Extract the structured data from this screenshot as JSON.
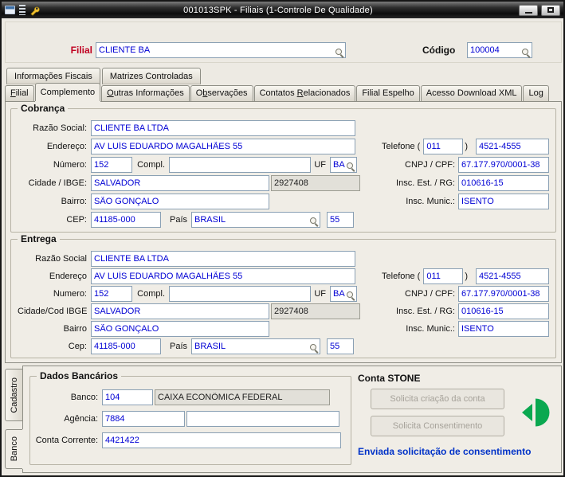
{
  "window": {
    "title": "001013SPK - Filiais (1-Controle De Qualidade)"
  },
  "colors": {
    "label_red": "#c00021",
    "input_text_blue": "#0000d4",
    "status_blue": "#0032c8",
    "stone_green": "#0aa850"
  },
  "icons": {
    "form": "form-window",
    "grip": "grip-dots",
    "wrench": "wrench",
    "minimize": "minimize-bar",
    "maximize": "maximize-box",
    "lookup": "magnifier",
    "stone": "stone-logo"
  },
  "header": {
    "filial_label": "Filial",
    "filial_value": "CLIENTE BA",
    "codigo_label": "Código",
    "codigo_value": "100004"
  },
  "fiscal_tabs": {
    "items": [
      {
        "label": "Informações Fiscais"
      },
      {
        "label": "Matrizes Controladas"
      }
    ]
  },
  "main_tabs": {
    "items": [
      {
        "pre": "",
        "u": "F",
        "post": "ilial"
      },
      {
        "pre": "Complemento",
        "u": "",
        "post": ""
      },
      {
        "pre": "",
        "u": "O",
        "post": "utras Informações"
      },
      {
        "pre": "O",
        "u": "b",
        "post": "servações"
      },
      {
        "pre": "Contatos ",
        "u": "R",
        "post": "elacionados"
      },
      {
        "pre": "Filial Espelho",
        "u": "",
        "post": ""
      },
      {
        "pre": "Acesso Download XML",
        "u": "",
        "post": ""
      },
      {
        "pre": "Log",
        "u": "",
        "post": ""
      }
    ]
  },
  "cobranca": {
    "title": "Cobrança",
    "labels": {
      "razao_social": "Razão Social:",
      "endereco": "Endereço:",
      "numero": "Número:",
      "compl": "Compl.",
      "uf": "UF",
      "cidade": "Cidade / IBGE:",
      "bairro": "Bairro:",
      "cep": "CEP:",
      "pais": "País",
      "telefone": "Telefone (",
      "telefone_close": ")",
      "cnpj": "CNPJ / CPF:",
      "insc_est": "Insc. Est. / RG:",
      "insc_munic": "Insc. Munic.:"
    },
    "values": {
      "razao_social": "CLIENTE BA LTDA",
      "endereco": "AV LUÍS EDUARDO MAGALHÃES 55",
      "numero": "152",
      "compl": "",
      "uf": "BA",
      "cidade": "SALVADOR",
      "ibge": "2927408",
      "bairro": "SÃO GONÇALO",
      "cep": "41185-000",
      "pais": "BRASIL",
      "pais_cod": "55",
      "ddd": "011",
      "telefone": "4521-4555",
      "cnpj": "67.177.970/0001-38",
      "insc_est": "010616-15",
      "insc_munic": "ISENTO"
    }
  },
  "entrega": {
    "title": "Entrega",
    "labels": {
      "razao_social": "Razão Social",
      "endereco": "Endereço",
      "numero": "Numero:",
      "compl": "Compl.",
      "uf": "UF",
      "cidade": "Cidade/Cod IBGE",
      "bairro": "Bairro",
      "cep": "Cep:",
      "pais": "País",
      "telefone": "Telefone (",
      "telefone_close": ")",
      "cnpj": "CNPJ / CPF:",
      "insc_est": "Insc. Est. / RG:",
      "insc_munic": "Insc. Munic.:"
    },
    "values": {
      "razao_social": "CLIENTE BA LTDA",
      "endereco": "AV LUÍS EDUARDO MAGALHÃES 55",
      "numero": "152",
      "compl": "",
      "uf": "BA",
      "cidade": "SALVADOR",
      "ibge": "2927408",
      "bairro": "SÃO GONÇALO",
      "cep": "41185-000",
      "pais": "BRASIL",
      "pais_cod": "55",
      "ddd": "011",
      "telefone": "4521-4555",
      "cnpj": "67.177.970/0001-38",
      "insc_est": "010616-15",
      "insc_munic": "ISENTO"
    }
  },
  "side_tabs": {
    "items": [
      {
        "label": "Cadastro"
      },
      {
        "label": "Banco"
      }
    ]
  },
  "dados_bancarios": {
    "title": "Dados Bancários",
    "banco_label": "Banco:",
    "banco_codigo": "104",
    "banco_nome": "CAIXA ECONÔMICA FEDERAL",
    "agencia_label": "Agência:",
    "agencia_value": "7884",
    "agencia_extra": "",
    "conta_label": "Conta Corrente:",
    "conta_value": "4421422"
  },
  "conta_stone": {
    "title": "Conta STONE",
    "button_criar": "Solicita criação da conta",
    "button_consentimento": "Solicita Consentimento",
    "status": "Enviada solicitação de consentimento"
  }
}
